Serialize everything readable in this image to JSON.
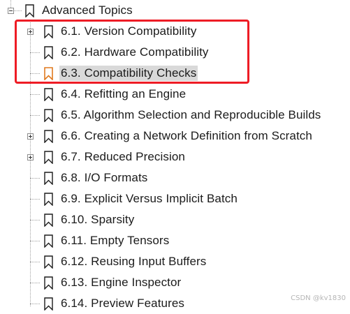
{
  "outline": {
    "parent": {
      "label": "Advanced Topics",
      "expander": "minus",
      "icon": "bookmark-icon"
    },
    "children": [
      {
        "label": "6.1. Version Compatibility",
        "expander": "plus",
        "icon": "bookmark-icon"
      },
      {
        "label": "6.2. Hardware Compatibility",
        "expander": "none",
        "icon": "bookmark-icon"
      },
      {
        "label": "6.3. Compatibility Checks",
        "expander": "none",
        "icon": "bookmark-icon",
        "selected": true,
        "icon_color": "#e07a1f"
      },
      {
        "label": "6.4. Refitting an Engine",
        "expander": "none",
        "icon": "bookmark-icon"
      },
      {
        "label": "6.5. Algorithm Selection and Reproducible Builds",
        "expander": "none",
        "icon": "bookmark-icon"
      },
      {
        "label": "6.6. Creating a Network Definition from Scratch",
        "expander": "plus",
        "icon": "bookmark-icon"
      },
      {
        "label": "6.7. Reduced Precision",
        "expander": "plus",
        "icon": "bookmark-icon"
      },
      {
        "label": "6.8. I/O Formats",
        "expander": "none",
        "icon": "bookmark-icon"
      },
      {
        "label": "6.9. Explicit Versus Implicit Batch",
        "expander": "none",
        "icon": "bookmark-icon"
      },
      {
        "label": "6.10. Sparsity",
        "expander": "none",
        "icon": "bookmark-icon"
      },
      {
        "label": "6.11. Empty Tensors",
        "expander": "none",
        "icon": "bookmark-icon"
      },
      {
        "label": "6.12. Reusing Input Buffers",
        "expander": "none",
        "icon": "bookmark-icon"
      },
      {
        "label": "6.13. Engine Inspector",
        "expander": "none",
        "icon": "bookmark-icon"
      },
      {
        "label": "6.14. Preview Features",
        "expander": "none",
        "icon": "bookmark-icon"
      }
    ]
  },
  "annotation": {
    "color": "#ee1c25"
  },
  "colors": {
    "selected_background": "#d9d9d9",
    "default_icon": "#1b1b1b",
    "selected_icon": "#e07a1f"
  },
  "watermark": "CSDN @kv1830"
}
